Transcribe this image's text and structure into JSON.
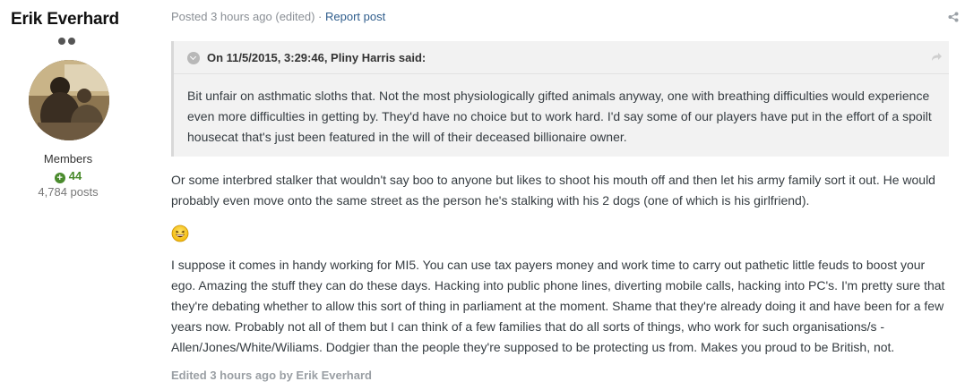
{
  "author": {
    "name": "Erik Everhard",
    "group": "Members",
    "reputation": "44",
    "posts": "4,784 posts"
  },
  "post": {
    "meta": "Posted 3 hours ago (edited) · ",
    "report_label": "Report post",
    "quote": {
      "citation": "On 11/5/2015, 3:29:46, Pliny Harris said:",
      "text": "Bit unfair on asthmatic sloths that. Not the most physiologically gifted animals anyway, one with breathing difficulties would experience even more difficulties in getting by. They'd have no choice but to work hard. I'd say some of our players have put in the effort of a spoilt housecat that's just been featured in the will of their deceased billionaire owner."
    },
    "paragraph1": "Or some interbred stalker that wouldn't say boo to anyone but likes to shoot his mouth off and then let his army family sort it out. He would probably even move onto the same street as the person he's stalking with his 2 dogs (one of which is his girlfriend).",
    "paragraph2": "I suppose it comes in handy working for MI5. You can use tax payers money and work time to carry out pathetic little feuds to boost your ego. Amazing the stuff they can do these days. Hacking into public phone lines, diverting mobile calls, hacking into PC's. I'm pretty sure that they're debating whether to allow this sort of thing in parliament at the moment. Shame that they're already doing it and have been for a few years now. Probably not all of them but I can think of a few families that do all sorts of things, who work for such organisations/s - Allen/Jones/White/Wiliams. Dodgier than the people they're supposed to be protecting us from. Makes you proud to be British, not.",
    "edited": "Edited 3 hours ago by Erik Everhard"
  },
  "icons": {
    "share": "share-icon",
    "quote_toggle": "chevron-down-icon",
    "quote_jump": "share-arrow-icon",
    "emoji": "laughing-emoji-icon"
  },
  "colors": {
    "link": "#2f5d8c",
    "reputation": "#4a8b2d",
    "quote_bg": "#f2f2f2"
  }
}
